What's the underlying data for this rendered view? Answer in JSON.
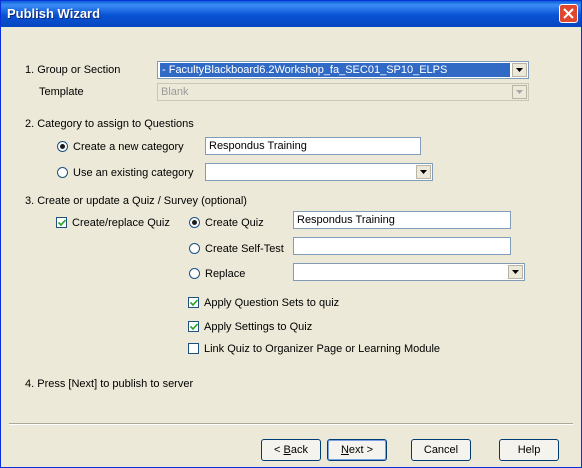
{
  "window": {
    "title": "Publish Wizard"
  },
  "section1": {
    "group_label": "1.  Group or Section",
    "group_value": "- FacultyBlackboard6.2Workshop_fa_SEC01_SP10_ELPS",
    "template_label": "Template",
    "template_value": "Blank"
  },
  "section2": {
    "heading": "2.  Category to assign to Questions",
    "create_label": "Create a new category",
    "create_value": "Respondus Training",
    "create_selected": true,
    "existing_label": "Use an existing category",
    "existing_value": ""
  },
  "section3": {
    "heading": "3.  Create or update a Quiz / Survey (optional)",
    "create_replace_label": "Create/replace Quiz",
    "create_replace_checked": true,
    "create_quiz_label": "Create Quiz",
    "create_quiz_value": "Respondus Training",
    "self_test_label": "Create Self-Test",
    "self_test_value": "",
    "replace_label": "Replace",
    "replace_value": "",
    "apply_sets_label": "Apply Question Sets to quiz",
    "apply_sets_checked": true,
    "apply_settings_label": "Apply Settings to Quiz",
    "apply_settings_checked": true,
    "link_label": "Link Quiz to Organizer Page or Learning Module",
    "link_checked": false
  },
  "section4": {
    "heading": "4.  Press [Next] to publish to server"
  },
  "buttons": {
    "back_prefix": "< ",
    "back_u": "B",
    "back_rest": "ack",
    "next_u": "N",
    "next_rest": "ext >",
    "cancel": "Cancel",
    "help": "Help"
  },
  "icons": {
    "close": "close-icon",
    "dropdown": "chevron-down-icon"
  }
}
